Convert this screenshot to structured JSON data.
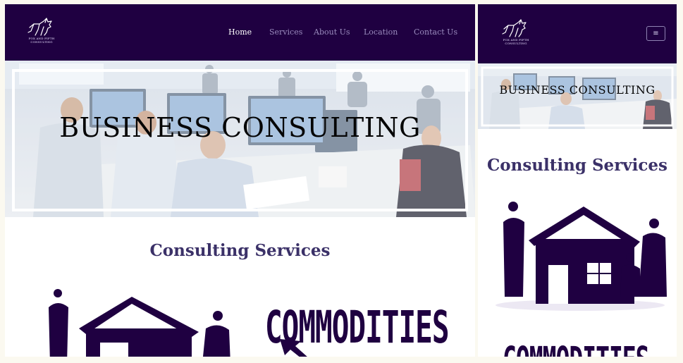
{
  "brand": {
    "logo_caption_line1": "FOX AND FIFTH",
    "logo_caption_line2": "CONSULTING"
  },
  "nav": {
    "items": [
      {
        "label": "Home",
        "active": true
      },
      {
        "label": "Services",
        "active": false
      },
      {
        "label": "About Us",
        "active": false
      },
      {
        "label": "Location",
        "active": false
      },
      {
        "label": "Contact Us",
        "active": false
      }
    ],
    "menu_toggle_icon": "hamburger-icon"
  },
  "hero": {
    "title": "BUSINESS CONSULTING"
  },
  "services": {
    "heading": "Consulting Services",
    "commodities_label": "COMMODITIES"
  },
  "colors": {
    "navbar": "#1f0041",
    "heading": "#3b3168",
    "page_background": "#fbf9f0"
  }
}
